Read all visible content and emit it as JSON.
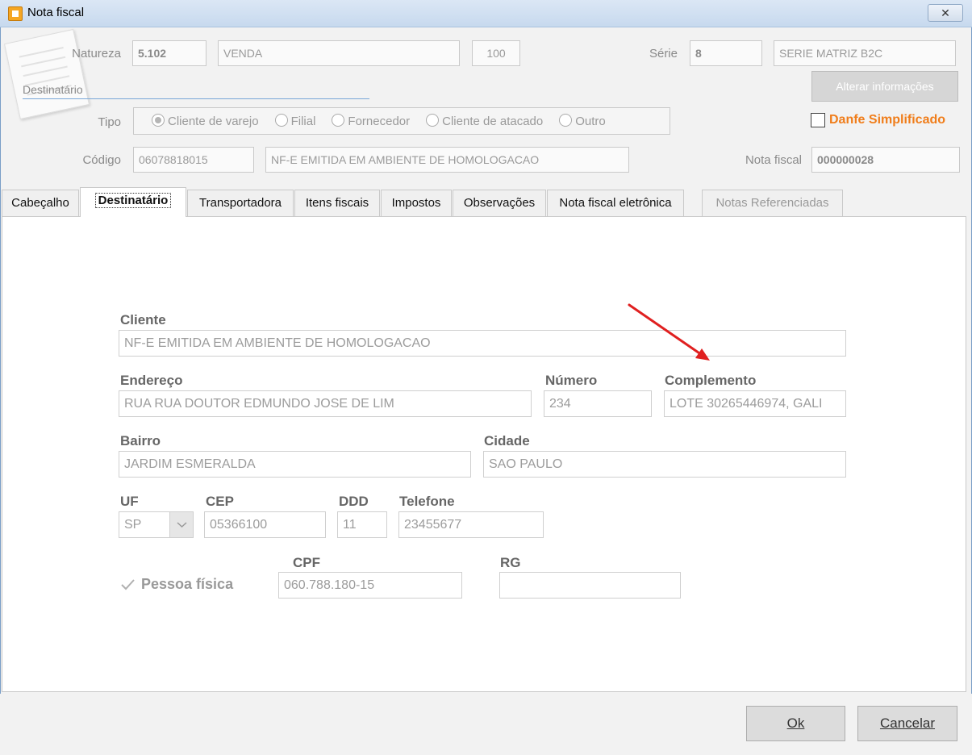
{
  "window": {
    "title": "Nota fiscal",
    "close_glyph": "✕"
  },
  "header": {
    "natureza_label": "Natureza",
    "natureza_code": "5.102",
    "natureza_desc": "VENDA",
    "natureza_num": "100",
    "serie_label": "Série",
    "serie_code": "8",
    "serie_desc": "SERIE MATRIZ B2C",
    "section_label": "Destinatário",
    "alterar_button": "Alterar informações",
    "tipo_label": "Tipo",
    "tipo_options": [
      "Cliente de varejo",
      "Filial",
      "Fornecedor",
      "Cliente de atacado",
      "Outro"
    ],
    "tipo_selected": "Cliente de varejo",
    "danfe_label": "Danfe Simplificado",
    "codigo_label": "Código",
    "codigo_value": "06078818015",
    "codigo_desc": "NF-E EMITIDA EM AMBIENTE DE HOMOLOGACAO",
    "nota_label": "Nota fiscal",
    "nota_value": "000000028"
  },
  "tabs": [
    {
      "label": "Cabeçalho",
      "state": "normal"
    },
    {
      "label": "Destinatário",
      "state": "active"
    },
    {
      "label": "Transportadora",
      "state": "normal"
    },
    {
      "label": "Itens fiscais",
      "state": "normal"
    },
    {
      "label": "Impostos",
      "state": "normal"
    },
    {
      "label": "Observações",
      "state": "normal"
    },
    {
      "label": "Nota fiscal eletrônica",
      "state": "normal"
    },
    {
      "label": "Notas Referenciadas",
      "state": "disabled"
    }
  ],
  "form": {
    "cliente_label": "Cliente",
    "cliente_value": "NF-E EMITIDA EM AMBIENTE DE HOMOLOGACAO",
    "endereco_label": "Endereço",
    "endereco_value": "RUA RUA DOUTOR EDMUNDO JOSE DE LIM",
    "numero_label": "Número",
    "numero_value": "234",
    "complemento_label": "Complemento",
    "complemento_value": "LOTE 30265446974, GALI",
    "bairro_label": "Bairro",
    "bairro_value": "JARDIM ESMERALDA",
    "cidade_label": "Cidade",
    "cidade_value": "SAO PAULO",
    "uf_label": "UF",
    "uf_value": "SP",
    "cep_label": "CEP",
    "cep_value": "05366100",
    "ddd_label": "DDD",
    "ddd_value": "11",
    "telefone_label": "Telefone",
    "telefone_value": "23455677",
    "pessoa_label": "Pessoa física",
    "pessoa_checked": true,
    "cpf_label": "CPF",
    "cpf_value": "060.788.180-15",
    "rg_label": "RG",
    "rg_value": ""
  },
  "footer": {
    "ok_label": "Ok",
    "cancel_label": "Cancelar"
  },
  "colors": {
    "annotation_arrow": "#e02020",
    "danfe": "#f07d1a"
  }
}
